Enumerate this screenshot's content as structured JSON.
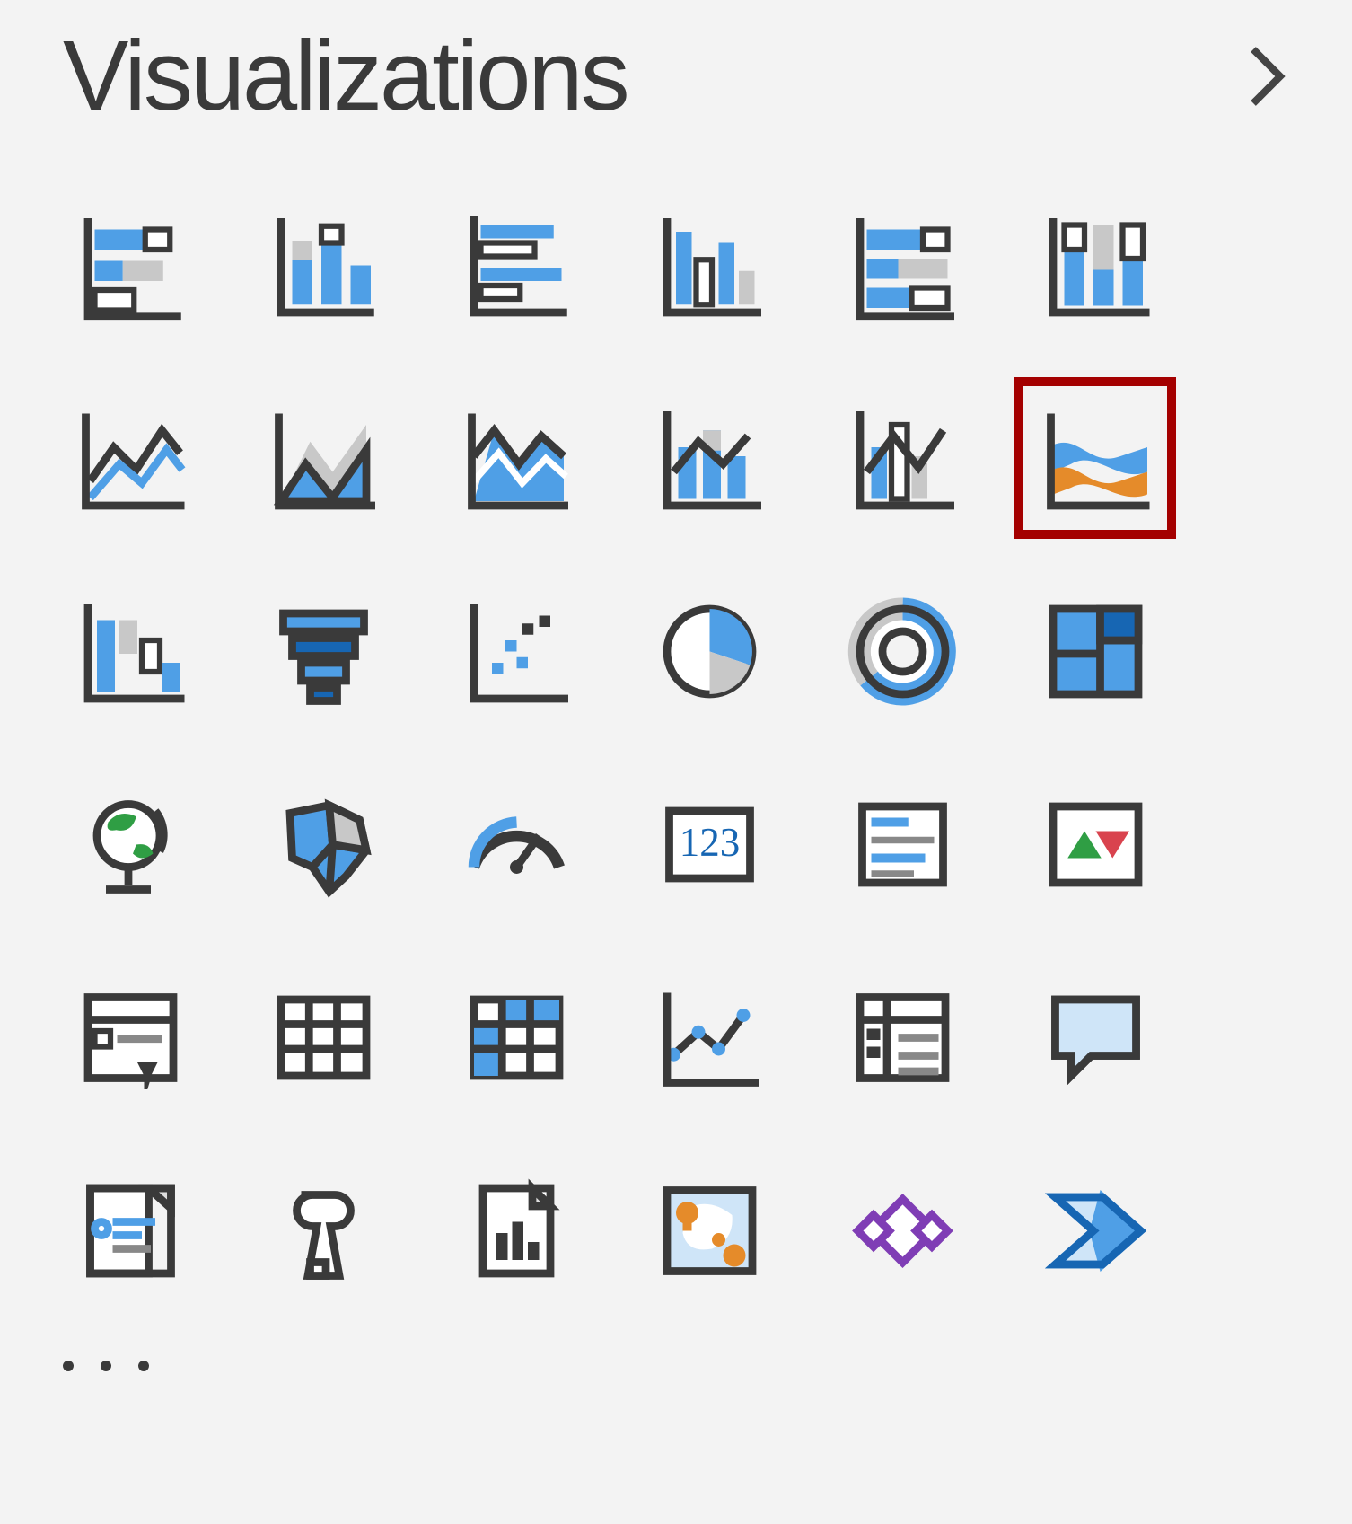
{
  "panel": {
    "title": "Visualizations",
    "collapse_icon": "chevron-right-icon",
    "more_options_icon": "ellipsis-icon",
    "highlighted_index": 11,
    "icons": [
      {
        "name": "stacked-bar-chart-icon",
        "label": "Stacked bar chart"
      },
      {
        "name": "stacked-column-chart-icon",
        "label": "Stacked column chart"
      },
      {
        "name": "clustered-bar-chart-icon",
        "label": "Clustered bar chart"
      },
      {
        "name": "clustered-column-chart-icon",
        "label": "Clustered column chart"
      },
      {
        "name": "hundred-stacked-bar-icon",
        "label": "100% Stacked bar chart"
      },
      {
        "name": "hundred-stacked-column-icon",
        "label": "100% Stacked column chart"
      },
      {
        "name": "line-chart-icon",
        "label": "Line chart"
      },
      {
        "name": "area-chart-icon",
        "label": "Area chart"
      },
      {
        "name": "stacked-area-chart-icon",
        "label": "Stacked area chart"
      },
      {
        "name": "line-stacked-column-icon",
        "label": "Line and stacked column chart"
      },
      {
        "name": "line-clustered-column-icon",
        "label": "Line and clustered column chart"
      },
      {
        "name": "ribbon-chart-icon",
        "label": "Ribbon chart"
      },
      {
        "name": "waterfall-chart-icon",
        "label": "Waterfall chart"
      },
      {
        "name": "funnel-chart-icon",
        "label": "Funnel"
      },
      {
        "name": "scatter-chart-icon",
        "label": "Scatter chart"
      },
      {
        "name": "pie-chart-icon",
        "label": "Pie chart"
      },
      {
        "name": "donut-chart-icon",
        "label": "Donut chart"
      },
      {
        "name": "treemap-chart-icon",
        "label": "Treemap"
      },
      {
        "name": "map-globe-icon",
        "label": "Map"
      },
      {
        "name": "filled-map-icon",
        "label": "Filled map"
      },
      {
        "name": "gauge-chart-icon",
        "label": "Gauge"
      },
      {
        "name": "card-chart-icon",
        "label": "Card"
      },
      {
        "name": "multi-row-card-icon",
        "label": "Multi-row card"
      },
      {
        "name": "kpi-chart-icon",
        "label": "KPI"
      },
      {
        "name": "slicer-icon",
        "label": "Slicer"
      },
      {
        "name": "table-icon",
        "label": "Table"
      },
      {
        "name": "matrix-icon",
        "label": "Matrix"
      },
      {
        "name": "r-script-visual-icon",
        "label": "R script visual"
      },
      {
        "name": "python-visual-icon",
        "label": "Python visual"
      },
      {
        "name": "qna-visual-icon",
        "label": "Q&A"
      },
      {
        "name": "key-influencers-icon",
        "label": "Key influencers"
      },
      {
        "name": "decomposition-tree-icon",
        "label": "Decomposition tree"
      },
      {
        "name": "paginated-report-icon",
        "label": "Paginated report"
      },
      {
        "name": "arcgis-map-icon",
        "label": "ArcGIS Maps"
      },
      {
        "name": "power-apps-icon",
        "label": "Power Apps"
      },
      {
        "name": "power-automate-icon",
        "label": "Power Automate"
      }
    ]
  }
}
